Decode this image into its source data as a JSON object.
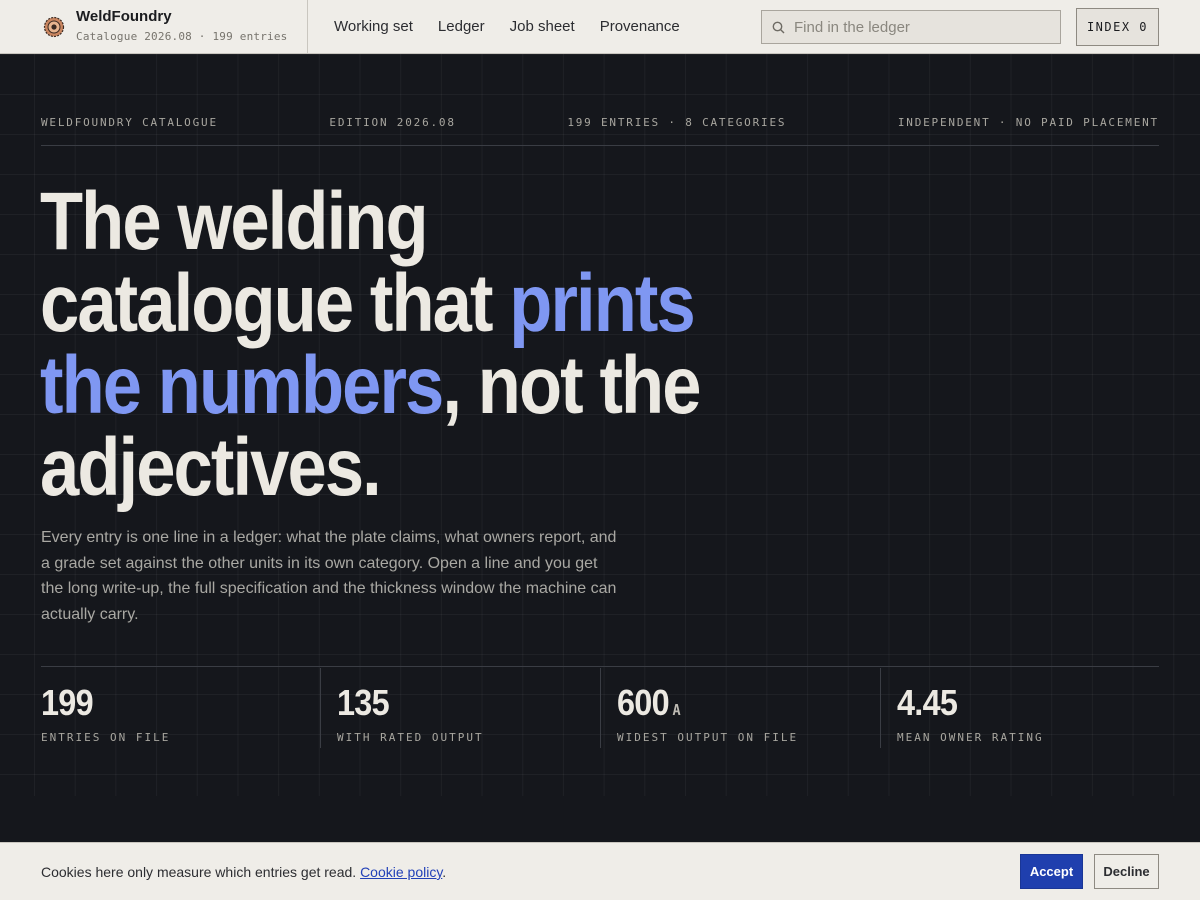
{
  "brand": {
    "logo_icon": "gear-target-icon",
    "name": "WeldFoundry",
    "subtitle": "Catalogue 2026.08 · 199 entries"
  },
  "nav": {
    "items": [
      {
        "label": "Working set"
      },
      {
        "label": "Ledger"
      },
      {
        "label": "Job sheet"
      },
      {
        "label": "Provenance"
      }
    ]
  },
  "search": {
    "icon": "search-icon",
    "placeholder": "Find in the ledger",
    "value": ""
  },
  "index_button": {
    "label": "INDEX 0"
  },
  "hero": {
    "strip": [
      "WELDFOUNDRY CATALOGUE",
      "EDITION 2026.08",
      "199 ENTRIES · 8 CATEGORIES",
      "INDEPENDENT · NO PAID PLACEMENT"
    ],
    "headline": {
      "part1": "The welding catalogue that ",
      "highlight": "prints the numbers",
      "part2": ", not the adjectives."
    },
    "lede": "Every entry is one line in a ledger: what the plate claims, what owners report, and a grade set against the other units in its own category. Open a line and you get the long write-up, the full specification and the thickness window the machine can actually carry."
  },
  "stats": [
    {
      "value": "199",
      "unit": "",
      "label": "ENTRIES ON FILE"
    },
    {
      "value": "135",
      "unit": "",
      "label": "WITH RATED OUTPUT"
    },
    {
      "value": "600",
      "unit": "A",
      "label": "WIDEST OUTPUT ON FILE"
    },
    {
      "value": "4.45",
      "unit": "",
      "label": "MEAN OWNER RATING"
    }
  ],
  "cookie": {
    "text": "Cookies here only measure which entries get read. ",
    "link": "Cookie policy",
    "trailing": ".",
    "accept": "Accept",
    "decline": "Decline"
  },
  "colors": {
    "accent": "#7f97f2",
    "background": "#15171c",
    "bar": "#efede8",
    "primary_button": "#1f3fae"
  }
}
